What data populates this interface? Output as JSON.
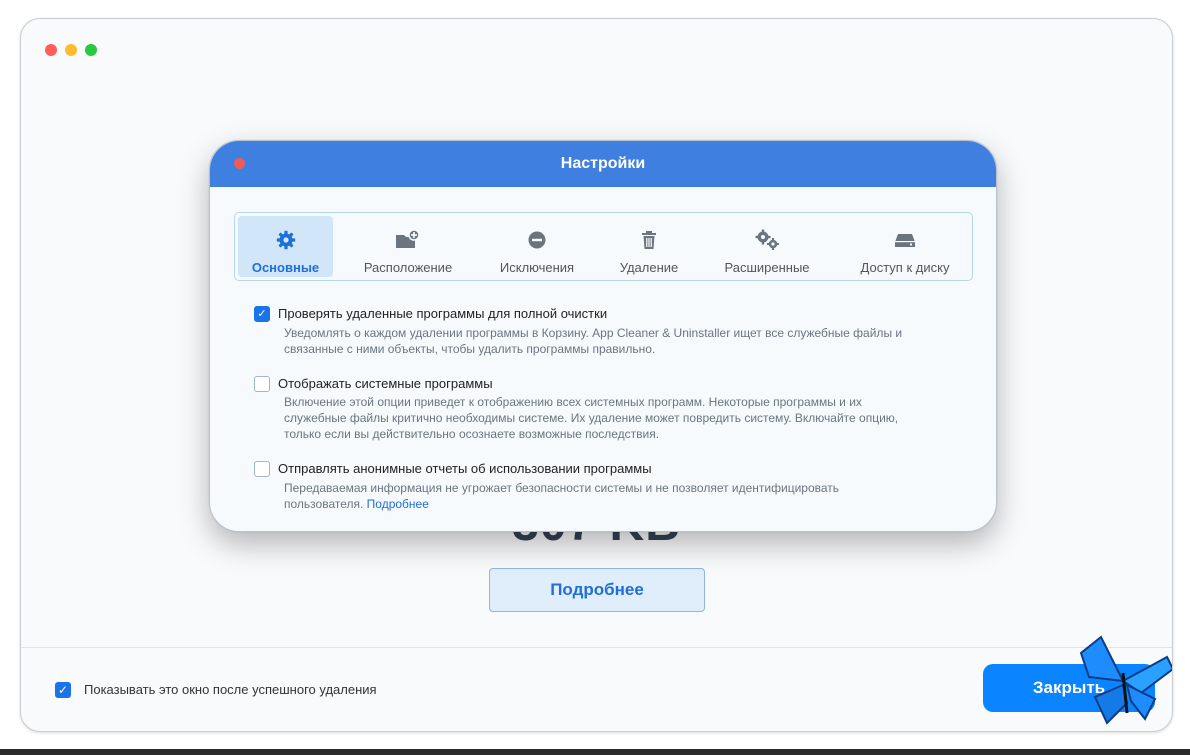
{
  "main_window": {
    "bg_size_text": "307 KB",
    "more_button_label": "Подробнее",
    "footer_checkbox_label": "Показывать это окно после успешного удаления",
    "close_button_label": "Закрыть"
  },
  "settings_dialog": {
    "title": "Настройки",
    "tabs": [
      {
        "label": "Основные",
        "icon": "gear-icon",
        "active": true
      },
      {
        "label": "Расположение",
        "icon": "folder-plus-icon",
        "active": false
      },
      {
        "label": "Исключения",
        "icon": "minus-circle-icon",
        "active": false
      },
      {
        "label": "Удаление",
        "icon": "trash-icon",
        "active": false
      },
      {
        "label": "Расширенные",
        "icon": "gears-icon",
        "active": false
      },
      {
        "label": "Доступ к диску",
        "icon": "disk-icon",
        "active": false
      }
    ],
    "options": [
      {
        "checked": true,
        "title": "Проверять удаленные программы для полной очистки",
        "desc_line1": "Уведомлять о каждом удалении программы в Корзину. App Cleaner & Uninstaller ищет все служебные файлы и",
        "desc_line2": "связанные с ними объекты, чтобы удалить программы правильно."
      },
      {
        "checked": false,
        "title": "Отображать системные программы",
        "desc_line1": "Включение этой опции приведет к отображению всех системных программ. Некоторые программы и их",
        "desc_line2": "служебные файлы критично необходимы системе. Их удаление может повредить систему. Включайте опцию,",
        "desc_line3": "только если вы действительно осознаете возможные последствия."
      },
      {
        "checked": false,
        "title": "Отправлять анонимные отчеты об использовании программы",
        "desc_line1": "Передаваемая информация не угрожает безопасности системы и не позволяет идентифицировать",
        "desc_line2": "пользователя.",
        "link": "Подробнее"
      }
    ]
  },
  "colors": {
    "accent": "#1a73e8",
    "titlebar": "#3f7fe0",
    "close_button": "#0a84ff"
  }
}
